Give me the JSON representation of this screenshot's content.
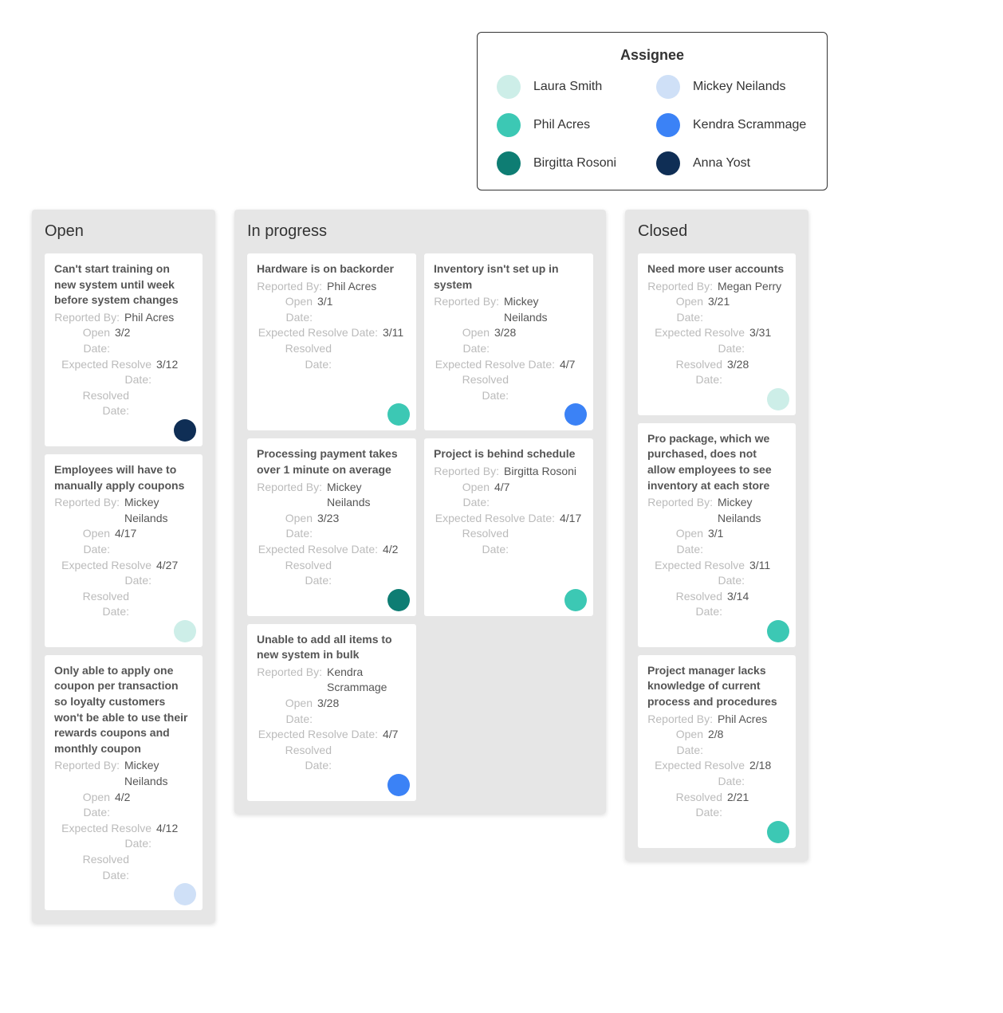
{
  "legend": {
    "title": "Assignee",
    "items": [
      {
        "name": "Laura Smith",
        "color": "#cdeee8"
      },
      {
        "name": "Mickey Neilands",
        "color": "#cfe0f7"
      },
      {
        "name": "Phil Acres",
        "color": "#3cc8b4"
      },
      {
        "name": "Kendra Scrammage",
        "color": "#3b82f6"
      },
      {
        "name": "Birgitta Rosoni",
        "color": "#0e7d73"
      },
      {
        "name": "Anna Yost",
        "color": "#0f2e55"
      }
    ]
  },
  "labels": {
    "reported_by": "Reported By:",
    "open_date": "Open Date:",
    "expected_resolve_date": "Expected Resolve Date:",
    "resolved_date": "Resolved Date:"
  },
  "columns": [
    {
      "title": "Open",
      "layout": "single",
      "cards": [
        {
          "title": "Can't start training on new system until week before system changes",
          "reported_by": "Phil Acres",
          "open_date": "3/2",
          "expected_resolve_date": "3/12",
          "resolved_date": "",
          "color": "#0f2e55",
          "assignee": "Anna Yost"
        },
        {
          "title": "Employees will have to manually apply coupons",
          "reported_by": "Mickey Neilands",
          "open_date": "4/17",
          "expected_resolve_date": "4/27",
          "resolved_date": "",
          "color": "#cdeee8",
          "assignee": "Laura Smith"
        },
        {
          "title": "Only able to apply one coupon per transaction so loyalty customers won't be able to use their rewards coupons and monthly coupon",
          "reported_by": "Mickey Neilands",
          "open_date": "4/2",
          "expected_resolve_date": "4/12",
          "resolved_date": "",
          "color": "#cfe0f7",
          "assignee": "Mickey Neilands"
        }
      ]
    },
    {
      "title": "In progress",
      "layout": "double",
      "cards": [
        {
          "title": "Hardware is on backorder",
          "reported_by": "Phil Acres",
          "open_date": "3/1",
          "expected_resolve_date": "3/11",
          "resolved_date": "",
          "color": "#3cc8b4",
          "assignee": "Phil Acres"
        },
        {
          "title": "Inventory isn't set up in system",
          "reported_by": "Mickey Neilands",
          "open_date": "3/28",
          "expected_resolve_date": "4/7",
          "resolved_date": "",
          "color": "#3b82f6",
          "assignee": "Kendra Scrammage"
        },
        {
          "title": "Processing payment takes over 1 minute on average",
          "reported_by": "Mickey Neilands",
          "open_date": "3/23",
          "expected_resolve_date": "4/2",
          "resolved_date": "",
          "color": "#0e7d73",
          "assignee": "Birgitta Rosoni"
        },
        {
          "title": "Project is behind schedule",
          "reported_by": "Birgitta Rosoni",
          "open_date": "4/7",
          "expected_resolve_date": "4/17",
          "resolved_date": "",
          "color": "#3cc8b4",
          "assignee": "Phil Acres"
        },
        {
          "title": "Unable to add all items to new system in bulk",
          "reported_by": "Kendra Scrammage",
          "open_date": "3/28",
          "expected_resolve_date": "4/7",
          "resolved_date": "",
          "color": "#3b82f6",
          "assignee": "Kendra Scrammage"
        }
      ]
    },
    {
      "title": "Closed",
      "layout": "single",
      "cards": [
        {
          "title": "Need more user accounts",
          "reported_by": "Megan Perry",
          "open_date": "3/21",
          "expected_resolve_date": "3/31",
          "resolved_date": "3/28",
          "color": "#cdeee8",
          "assignee": "Laura Smith"
        },
        {
          "title": "Pro package, which we purchased, does not allow employees to see inventory at each store",
          "reported_by": "Mickey Neilands",
          "open_date": "3/1",
          "expected_resolve_date": "3/11",
          "resolved_date": "3/14",
          "color": "#3cc8b4",
          "assignee": "Phil Acres"
        },
        {
          "title": "Project manager lacks knowledge of current process and procedures",
          "reported_by": "Phil Acres",
          "open_date": "2/8",
          "expected_resolve_date": "2/18",
          "resolved_date": "2/21",
          "color": "#3cc8b4",
          "assignee": "Phil Acres"
        }
      ]
    }
  ]
}
